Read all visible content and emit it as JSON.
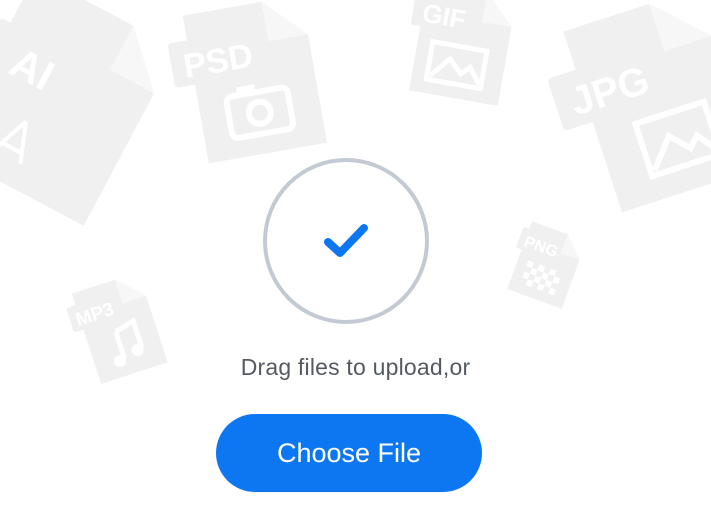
{
  "background_files": [
    {
      "tag": "AI",
      "icon": "pen-tool-icon"
    },
    {
      "tag": "PSD",
      "icon": "camera-icon"
    },
    {
      "tag": "GIF",
      "icon": "image-icon"
    },
    {
      "tag": "JPG",
      "icon": "image-icon"
    },
    {
      "tag": "PNG",
      "icon": "checker-icon"
    },
    {
      "tag": "MP3",
      "icon": "music-note-icon"
    }
  ],
  "upload": {
    "status_icon": "checkmark-icon",
    "prompt": "Drag files to upload,or",
    "button_label": "Choose File"
  },
  "colors": {
    "accent": "#0d77f2",
    "circle_border": "#c4cad3",
    "text": "#555a62",
    "background_icons": "#f0f0f0"
  }
}
